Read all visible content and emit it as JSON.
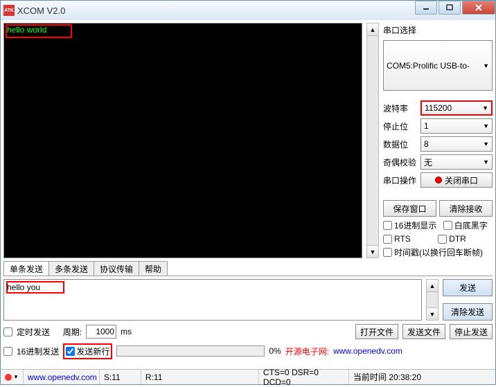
{
  "window": {
    "title": "XCOM V2.0",
    "icon_text": "ATK"
  },
  "terminal": {
    "output": "hello world"
  },
  "side": {
    "port_label": "串口选择",
    "port_value": "COM5:Prolific USB-to-",
    "baud_label": "波特率",
    "baud_value": "115200",
    "stop_label": "停止位",
    "stop_value": "1",
    "data_label": "数据位",
    "data_value": "8",
    "parity_label": "奇偶校验",
    "parity_value": "无",
    "op_label": "串口操作",
    "op_button": "关闭串口",
    "save_win": "保存窗口",
    "clear_recv": "清除接收",
    "hex_disp": "16进制显示",
    "white_bg": "白底黑字",
    "rts": "RTS",
    "dtr": "DTR",
    "timestamp": "时间戳(以换行回车断帧)"
  },
  "tabs": {
    "t1": "单条发送",
    "t2": "多条发送",
    "t3": "协议传输",
    "t4": "帮助"
  },
  "send": {
    "input": "hello you",
    "send_btn": "发送",
    "clear_btn": "清除发送"
  },
  "bottom": {
    "timed_send": "定时发送",
    "period_label": "周期:",
    "period_value": "1000",
    "period_unit": "ms",
    "open_file": "打开文件",
    "send_file": "发送文件",
    "stop_send": "停止发送",
    "hex_send": "16进制发送",
    "newline": "发送新行",
    "percent": "0%",
    "link_label": "开源电子网:",
    "link_url": "www.openedv.com"
  },
  "status": {
    "url": "www.openedv.com",
    "s": "S:11",
    "r": "R:11",
    "line": "CTS=0 DSR=0 DCD=0",
    "time_label": "当前时间",
    "time": "20:38:20"
  }
}
